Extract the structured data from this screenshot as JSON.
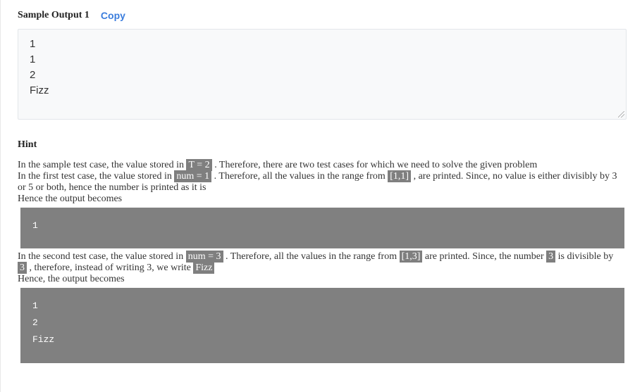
{
  "sample_output": {
    "title": "Sample Output 1",
    "copy_label": "Copy",
    "lines": [
      "1",
      "1",
      "2",
      "Fizz"
    ]
  },
  "hint": {
    "title": "Hint",
    "p1": {
      "a": "In the sample test case, the value stored in ",
      "hl": "T = 2",
      "b": " . Therefore, there are two test cases for which we need to solve the given problem"
    },
    "p2": {
      "a": "In the first test case, the value stored in ",
      "hl1": "num = 1",
      "b": " . Therefore, all the values in the range from ",
      "hl2": "[1,1]",
      "c": " , are printed. Since, no value is either divisibly by 3 or 5 or both, hence the number is printed as it is"
    },
    "p3": "Hence the output becomes",
    "code1": [
      "1"
    ],
    "p4": {
      "a": "In the second test case, the value stored in ",
      "hl1": "num = 3",
      "b": " . Therefore, all the values in the range from ",
      "hl2": "[1,3]",
      "c": " are printed. Since, the number ",
      "hl3": "3",
      "d": " is divisible by ",
      "hl4": "3",
      "e": " , therefore, instead of writing 3, we write ",
      "hl5": "Fizz"
    },
    "p5": "Hence, the output becomes",
    "code2": [
      "1",
      "2",
      "Fizz"
    ]
  },
  "colors": {
    "copy_link": "#3b7ddd",
    "highlight_bg": "#7f7f7f",
    "code_bg": "#808080",
    "output_bg": "#f8f9fa"
  }
}
